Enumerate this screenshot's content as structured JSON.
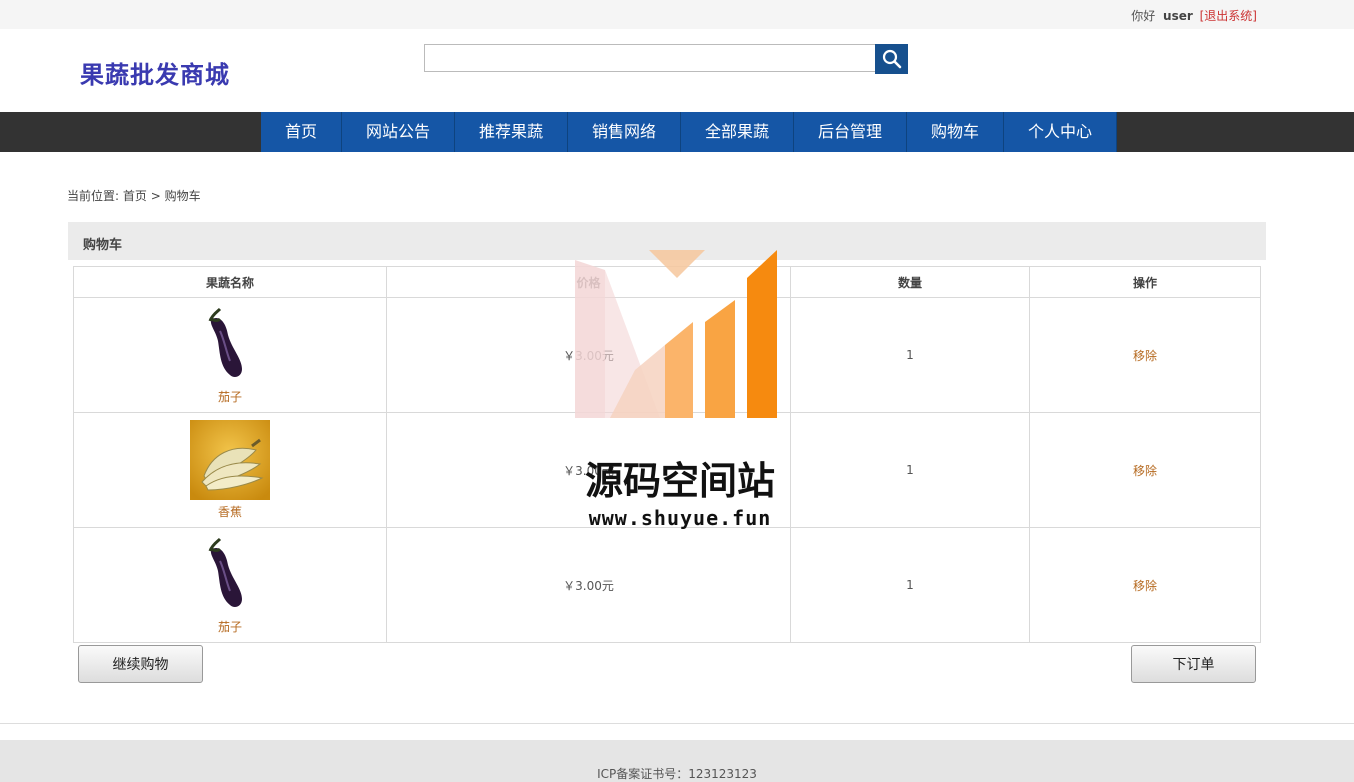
{
  "topbar": {
    "greeting": "你好",
    "username": "user",
    "logout": "[退出系统]"
  },
  "header": {
    "logo": "果蔬批发商城",
    "search_placeholder": ""
  },
  "nav": [
    "首页",
    "网站公告",
    "推荐果蔬",
    "销售网络",
    "全部果蔬",
    "后台管理",
    "购物车",
    "个人中心"
  ],
  "breadcrumb": {
    "prefix": "当前位置:",
    "home": "首页",
    "sep": ">",
    "current": "购物车"
  },
  "panel": {
    "title": "购物车"
  },
  "table": {
    "headers": [
      "果蔬名称",
      "价格",
      "数量",
      "操作"
    ],
    "rows": [
      {
        "name": "茄子",
        "image": "eggplant-image",
        "price": "￥3.00元",
        "qty": "1",
        "action": "移除"
      },
      {
        "name": "香蕉",
        "image": "banana-image",
        "price": "￥3.00元",
        "qty": "1",
        "action": "移除"
      },
      {
        "name": "茄子",
        "image": "eggplant-image",
        "price": "￥3.00元",
        "qty": "1",
        "action": "移除"
      }
    ]
  },
  "buttons": {
    "continue": "继续购物",
    "order": "下订单"
  },
  "footer": {
    "icp": "ICP备案证书号：123123123"
  },
  "watermark": {
    "title": "源码空间站",
    "url": "www.shuyue.fun"
  },
  "colors": {
    "nav_bg": "#333333",
    "nav_item": "#1556a6",
    "accent": "#b5691f",
    "logo": "#3a3ab0"
  }
}
